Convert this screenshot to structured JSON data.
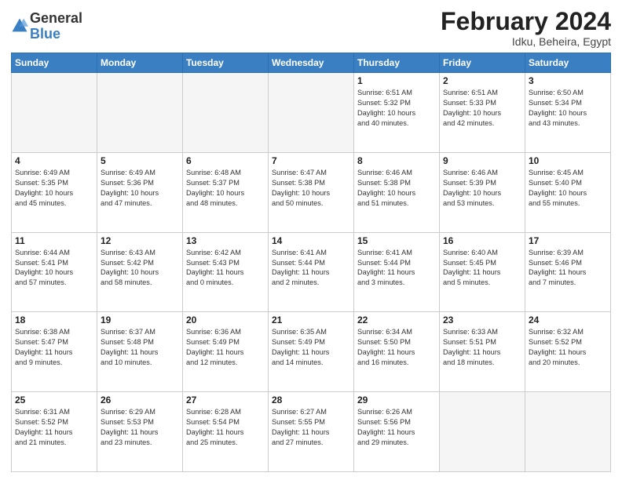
{
  "header": {
    "logo_general": "General",
    "logo_blue": "Blue",
    "month_title": "February 2024",
    "location": "Idku, Beheira, Egypt"
  },
  "weekdays": [
    "Sunday",
    "Monday",
    "Tuesday",
    "Wednesday",
    "Thursday",
    "Friday",
    "Saturday"
  ],
  "weeks": [
    [
      {
        "day": "",
        "info": ""
      },
      {
        "day": "",
        "info": ""
      },
      {
        "day": "",
        "info": ""
      },
      {
        "day": "",
        "info": ""
      },
      {
        "day": "1",
        "info": "Sunrise: 6:51 AM\nSunset: 5:32 PM\nDaylight: 10 hours\nand 40 minutes."
      },
      {
        "day": "2",
        "info": "Sunrise: 6:51 AM\nSunset: 5:33 PM\nDaylight: 10 hours\nand 42 minutes."
      },
      {
        "day": "3",
        "info": "Sunrise: 6:50 AM\nSunset: 5:34 PM\nDaylight: 10 hours\nand 43 minutes."
      }
    ],
    [
      {
        "day": "4",
        "info": "Sunrise: 6:49 AM\nSunset: 5:35 PM\nDaylight: 10 hours\nand 45 minutes."
      },
      {
        "day": "5",
        "info": "Sunrise: 6:49 AM\nSunset: 5:36 PM\nDaylight: 10 hours\nand 47 minutes."
      },
      {
        "day": "6",
        "info": "Sunrise: 6:48 AM\nSunset: 5:37 PM\nDaylight: 10 hours\nand 48 minutes."
      },
      {
        "day": "7",
        "info": "Sunrise: 6:47 AM\nSunset: 5:38 PM\nDaylight: 10 hours\nand 50 minutes."
      },
      {
        "day": "8",
        "info": "Sunrise: 6:46 AM\nSunset: 5:38 PM\nDaylight: 10 hours\nand 51 minutes."
      },
      {
        "day": "9",
        "info": "Sunrise: 6:46 AM\nSunset: 5:39 PM\nDaylight: 10 hours\nand 53 minutes."
      },
      {
        "day": "10",
        "info": "Sunrise: 6:45 AM\nSunset: 5:40 PM\nDaylight: 10 hours\nand 55 minutes."
      }
    ],
    [
      {
        "day": "11",
        "info": "Sunrise: 6:44 AM\nSunset: 5:41 PM\nDaylight: 10 hours\nand 57 minutes."
      },
      {
        "day": "12",
        "info": "Sunrise: 6:43 AM\nSunset: 5:42 PM\nDaylight: 10 hours\nand 58 minutes."
      },
      {
        "day": "13",
        "info": "Sunrise: 6:42 AM\nSunset: 5:43 PM\nDaylight: 11 hours\nand 0 minutes."
      },
      {
        "day": "14",
        "info": "Sunrise: 6:41 AM\nSunset: 5:44 PM\nDaylight: 11 hours\nand 2 minutes."
      },
      {
        "day": "15",
        "info": "Sunrise: 6:41 AM\nSunset: 5:44 PM\nDaylight: 11 hours\nand 3 minutes."
      },
      {
        "day": "16",
        "info": "Sunrise: 6:40 AM\nSunset: 5:45 PM\nDaylight: 11 hours\nand 5 minutes."
      },
      {
        "day": "17",
        "info": "Sunrise: 6:39 AM\nSunset: 5:46 PM\nDaylight: 11 hours\nand 7 minutes."
      }
    ],
    [
      {
        "day": "18",
        "info": "Sunrise: 6:38 AM\nSunset: 5:47 PM\nDaylight: 11 hours\nand 9 minutes."
      },
      {
        "day": "19",
        "info": "Sunrise: 6:37 AM\nSunset: 5:48 PM\nDaylight: 11 hours\nand 10 minutes."
      },
      {
        "day": "20",
        "info": "Sunrise: 6:36 AM\nSunset: 5:49 PM\nDaylight: 11 hours\nand 12 minutes."
      },
      {
        "day": "21",
        "info": "Sunrise: 6:35 AM\nSunset: 5:49 PM\nDaylight: 11 hours\nand 14 minutes."
      },
      {
        "day": "22",
        "info": "Sunrise: 6:34 AM\nSunset: 5:50 PM\nDaylight: 11 hours\nand 16 minutes."
      },
      {
        "day": "23",
        "info": "Sunrise: 6:33 AM\nSunset: 5:51 PM\nDaylight: 11 hours\nand 18 minutes."
      },
      {
        "day": "24",
        "info": "Sunrise: 6:32 AM\nSunset: 5:52 PM\nDaylight: 11 hours\nand 20 minutes."
      }
    ],
    [
      {
        "day": "25",
        "info": "Sunrise: 6:31 AM\nSunset: 5:52 PM\nDaylight: 11 hours\nand 21 minutes."
      },
      {
        "day": "26",
        "info": "Sunrise: 6:29 AM\nSunset: 5:53 PM\nDaylight: 11 hours\nand 23 minutes."
      },
      {
        "day": "27",
        "info": "Sunrise: 6:28 AM\nSunset: 5:54 PM\nDaylight: 11 hours\nand 25 minutes."
      },
      {
        "day": "28",
        "info": "Sunrise: 6:27 AM\nSunset: 5:55 PM\nDaylight: 11 hours\nand 27 minutes."
      },
      {
        "day": "29",
        "info": "Sunrise: 6:26 AM\nSunset: 5:56 PM\nDaylight: 11 hours\nand 29 minutes."
      },
      {
        "day": "",
        "info": ""
      },
      {
        "day": "",
        "info": ""
      }
    ]
  ]
}
